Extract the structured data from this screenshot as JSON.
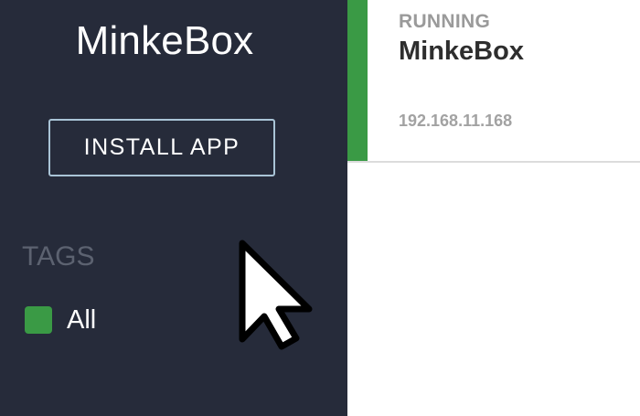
{
  "sidebar": {
    "brand": "MinkeBox",
    "install_button": "INSTALL APP",
    "tags_heading": "TAGS",
    "tags": [
      {
        "label": "All",
        "color": "#3a9a45"
      }
    ]
  },
  "apps": [
    {
      "status": "RUNNING",
      "name": "MinkeBox",
      "ip": "192.168.11.168",
      "status_color": "#3a9a45"
    }
  ],
  "colors": {
    "sidebar_bg": "#262b3a",
    "accent_green": "#3a9a45",
    "button_border": "#a9c4d6"
  },
  "cursor": {
    "icon": "arrow-pointer-icon"
  }
}
